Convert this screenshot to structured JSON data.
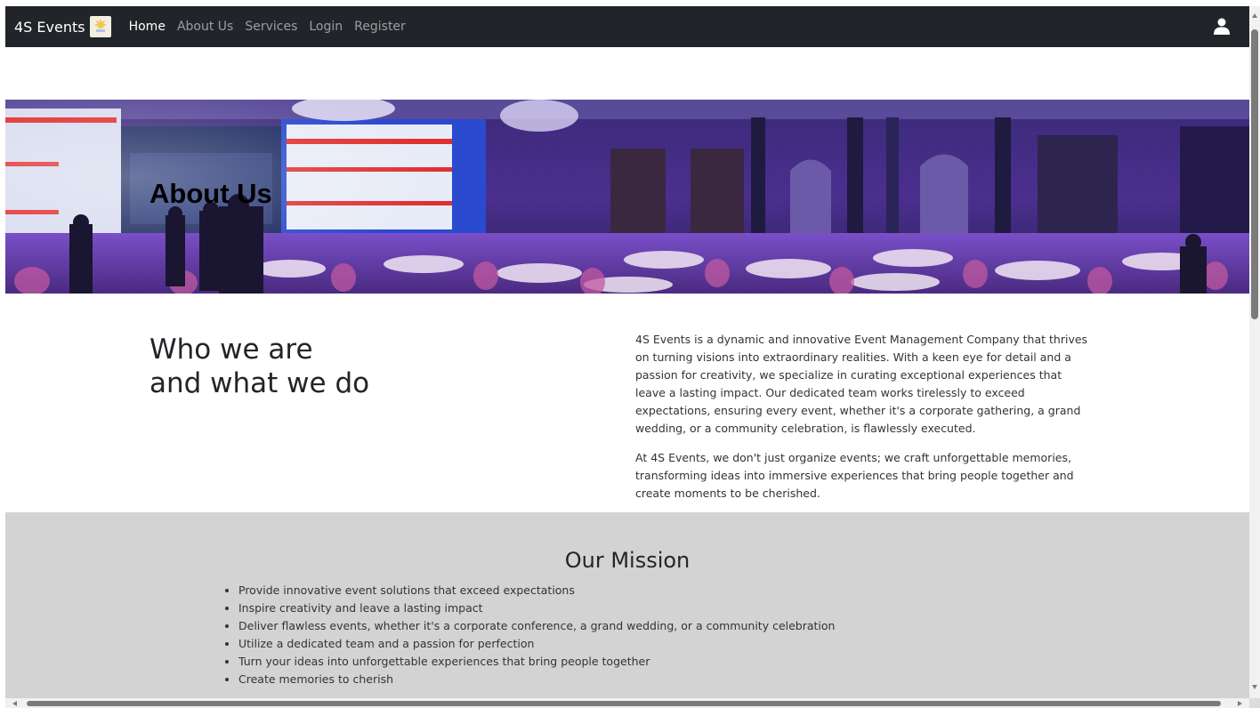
{
  "navbar": {
    "brand": "4S Events",
    "links": [
      {
        "label": "Home",
        "active": true
      },
      {
        "label": "About Us",
        "active": false
      },
      {
        "label": "Services",
        "active": false
      },
      {
        "label": "Login",
        "active": false
      },
      {
        "label": "Register",
        "active": false
      }
    ],
    "user_icon": "user-icon"
  },
  "hero": {
    "title": "About Us"
  },
  "who": {
    "title_line1": "Who we are",
    "title_line2": "and what we do",
    "paragraphs": [
      "4S Events is a dynamic and innovative Event Management Company that thrives on turning visions into extraordinary realities. With a keen eye for detail and a passion for creativity, we specialize in curating exceptional experiences that leave a lasting impact. Our dedicated team works tirelessly to exceed expectations, ensuring every event, whether it's a corporate gathering, a grand wedding, or a community celebration, is flawlessly executed.",
      "At 4S Events, we don't just organize events; we craft unforgettable memories, transforming ideas into immersive experiences that bring people together and create moments to be cherished."
    ]
  },
  "mission": {
    "title": "Our Mission",
    "items": [
      "Provide innovative event solutions that exceed expectations",
      "Inspire creativity and leave a lasting impact",
      "Deliver flawless events, whether it's a corporate conference, a grand wedding, or a community celebration",
      "Utilize a dedicated team and a passion for perfection",
      "Turn your ideas into unforgettable experiences that bring people together",
      "Create memories to cherish"
    ]
  },
  "colors": {
    "navbar_bg": "#212529",
    "mission_bg": "#d3d3d3",
    "hero_purple": "#5a2fb0"
  }
}
